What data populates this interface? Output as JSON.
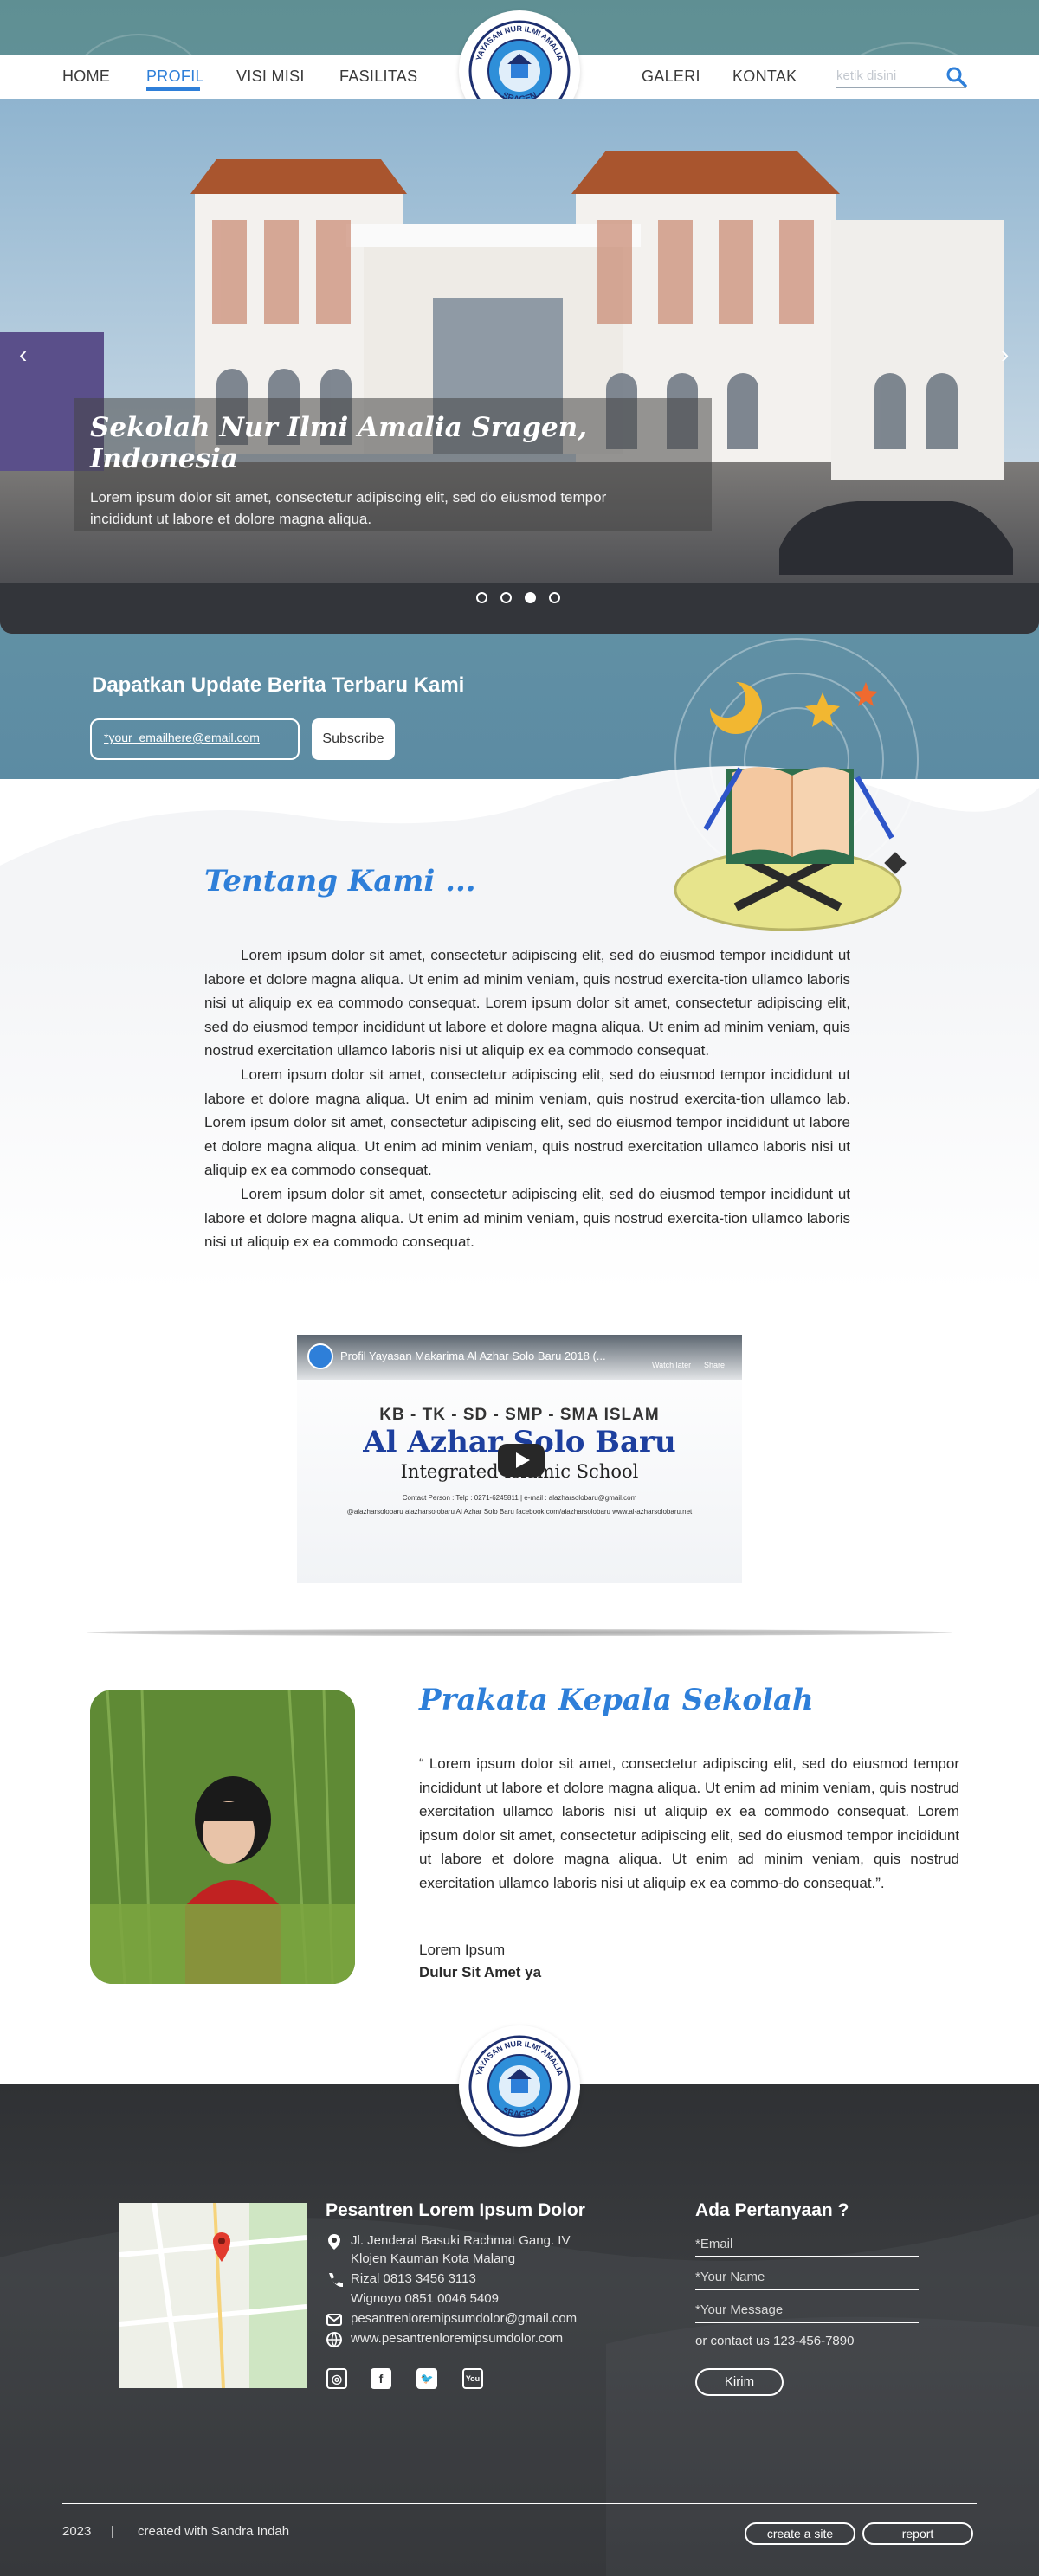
{
  "nav": {
    "items": [
      "HOME",
      "PROFIL",
      "VISI MISI",
      "FASILITAS"
    ],
    "right_items": [
      "GALERI",
      "KONTAK"
    ],
    "active": "PROFIL",
    "search_placeholder": "ketik disini"
  },
  "logo": {
    "top_text": "YAYASAN NUR ILMI AMALIA",
    "bottom_text": "SRAGEN"
  },
  "hero": {
    "title": "Sekolah Nur Ilmi Amalia Sragen, Indonesia",
    "text": "Lorem ipsum dolor sit amet, consectetur adipiscing elit, sed do eiusmod tempor incididunt ut labore et dolore magna aliqua.",
    "prev_arrow": "‹",
    "next_arrow": "›",
    "slides": 4,
    "active_slide": 3
  },
  "newsletter": {
    "title": "Dapatkan Update Berita Terbaru Kami",
    "email_value": "*your_emailhere@email.com",
    "button": "Subscribe"
  },
  "about": {
    "title": "Tentang Kami ...",
    "paragraphs": [
      "Lorem ipsum dolor sit amet, consectetur adipiscing elit, sed do eiusmod tempor incididunt ut labore et dolore magna aliqua. Ut enim ad minim veniam, quis nostrud exercita-tion ullamco laboris nisi ut aliquip ex ea commodo consequat. Lorem ipsum dolor sit amet, consectetur adipiscing elit, sed do eiusmod tempor incididunt ut labore et dolore magna aliqua. Ut enim ad minim veniam, quis nostrud exercitation ullamco laboris nisi ut aliquip ex ea commodo consequat.",
      "Lorem ipsum dolor sit amet, consectetur adipiscing elit, sed do eiusmod tempor incididunt ut labore et dolore magna aliqua. Ut enim ad minim veniam, quis nostrud exercita-tion ullamco lab. Lorem ipsum dolor sit amet, consectetur adipiscing elit, sed do eiusmod tempor incididunt ut labore et dolore magna aliqua. Ut enim ad minim veniam, quis nostrud exercitation ullamco laboris nisi ut aliquip ex ea commodo consequat.",
      "Lorem ipsum dolor sit amet, consectetur adipiscing elit, sed do eiusmod tempor incididunt ut labore et dolore magna aliqua. Ut enim ad minim veniam, quis nostrud exercita-tion ullamco laboris nisi ut aliquip ex ea commodo consequat."
    ]
  },
  "video": {
    "title": "Profil Yayasan Makarima Al Azhar Solo Baru 2018 (...",
    "watch_later": "Watch later",
    "share": "Share",
    "line1": "KB - TK - SD - SMP - SMA ISLAM",
    "line2": "Al Azhar Solo Baru",
    "line3": "Integrated Islamic School",
    "line4": "Contact Person : Telp : 0271-6245811 | e-mail : alazharsolobaru@gmail.com",
    "line5": "@alazharsolobaru   alazharsolobaru   Al Azhar Solo Baru   facebook.com/alazharsolobaru   www.al-azharsolobaru.net"
  },
  "principal": {
    "title": "Prakata Kepala Sekolah",
    "quote": "“ Lorem ipsum dolor sit amet, consectetur adipiscing elit, sed do eiusmod tempor incididunt ut labore et dolore magna aliqua. Ut enim ad minim veniam, quis nostrud exercitation ullamco laboris nisi ut aliquip ex ea commodo consequat.  Lorem ipsum dolor sit amet, consectetur adipiscing elit, sed do eiusmod tempor incididunt ut labore et dolore magna aliqua. Ut enim ad minim veniam, quis nostrud exercitation ullamco laboris nisi ut aliquip ex ea commo-do consequat.”.",
    "name": "Lorem Ipsum",
    "role": "Dulur Sit Amet ya"
  },
  "footer": {
    "school_name": "Pesantren Lorem Ipsum Dolor",
    "address": [
      "Jl. Jenderal Basuki Rachmat Gang. IV",
      "Klojen Kauman Kota Malang"
    ],
    "phones": [
      "Rizal 0813 3456 3113",
      "Wignoyo  0851 0046 5409"
    ],
    "email": "pesantrenloremipsumdolor@gmail.com",
    "website": "www.pesantrenloremipsumdolor.com",
    "social_icons": [
      "instagram-icon",
      "facebook-icon",
      "twitter-icon",
      "youtube-icon"
    ],
    "question_title": "Ada Pertanyaan ?",
    "form": {
      "email_placeholder": "*Email",
      "name_placeholder": "*Your Name",
      "message_placeholder": "*Your Message",
      "contact_us": "or contact us 123-456-7890",
      "submit": "Kirim"
    },
    "year": "2023",
    "separator": "|",
    "credit": "created with Sandra Indah",
    "buttons": [
      "create a site",
      "report"
    ]
  },
  "colors": {
    "accent": "#2e7fd9",
    "teal_band": "#5f8f93",
    "footer_bg": "#2f3134"
  }
}
